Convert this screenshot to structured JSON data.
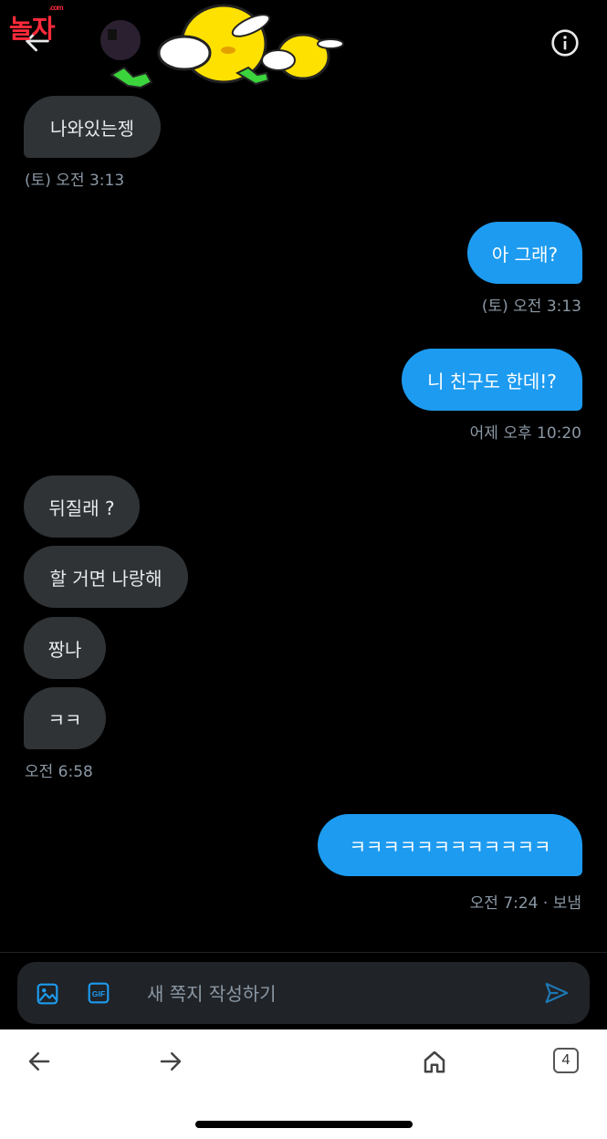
{
  "watermark": {
    "main": "놀자",
    "small": ".com"
  },
  "messages": [
    {
      "dir": "in",
      "text": "나와있는젱"
    },
    {
      "dir": "out",
      "text": "아 그래?"
    },
    {
      "dir": "out",
      "text": "니 친구도 한데!?"
    },
    {
      "dir": "in",
      "text": "뒤질래 ?"
    },
    {
      "dir": "in",
      "text": "할 거면 나랑해"
    },
    {
      "dir": "in",
      "text": "짱나"
    },
    {
      "dir": "in",
      "text": "ㅋㅋ"
    },
    {
      "dir": "out",
      "text": "ㅋㅋㅋㅋㅋㅋㅋㅋㅋㅋㅋㅋ"
    }
  ],
  "timestamps": [
    "(토) 오전 3:13",
    "(토) 오전 3:13",
    "어제 오후 10:20",
    "오전 6:58",
    "오전 7:24 · 보냄"
  ],
  "composer": {
    "placeholder": "새 쪽지 작성하기"
  },
  "browser": {
    "tab_count": "4"
  },
  "colors": {
    "background": "#000000",
    "incoming_bubble": "#2f3336",
    "outgoing_bubble": "#1d9bf0",
    "timestamp": "#8b98a5",
    "accent": "#1d9bf0"
  }
}
